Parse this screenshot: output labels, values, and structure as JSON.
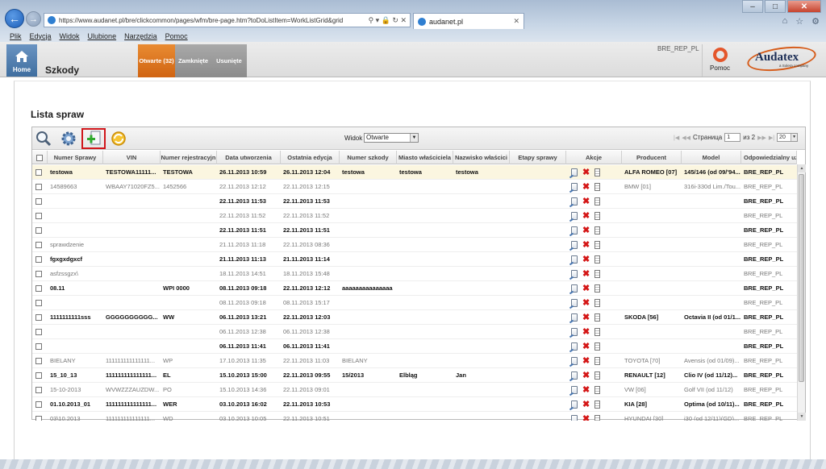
{
  "browser": {
    "url": "https://www.audanet.pl/bre/clickcommon/pages/wfm/bre-page.htm?toDoListItem=WorkListGrid&grid",
    "tab_title": "audanet.pl",
    "menu": [
      "Plik",
      "Edycja",
      "Widok",
      "Ulubione",
      "Narzędzia",
      "Pomoc"
    ]
  },
  "header": {
    "home_label": "Home",
    "module_title": "Szkody",
    "tabs": [
      {
        "label": "Otwarte (32)",
        "active": true
      },
      {
        "label": "Zamknięte",
        "active": false
      },
      {
        "label": "Usunięte",
        "active": false
      }
    ],
    "user": "BRE_REP_PL",
    "help_label": "Pomoc",
    "logo_name": "Audatex",
    "logo_sub": "a Solera company"
  },
  "list": {
    "title": "Lista spraw",
    "view_label": "Widok",
    "view_value": "Otwarte",
    "pager": {
      "label": "Страница",
      "page": "1",
      "of_label": "из 2",
      "page_size": "20"
    }
  },
  "columns": [
    "Numer Sprawy",
    "VIN",
    "Numer rejestracyjn",
    "Data utworzenia",
    "Ostatnia edycja",
    "Numer szkody",
    "Miasto właściciela",
    "Nazwisko właścici",
    "Etapy sprawy",
    "Akcje",
    "Producent",
    "Model",
    "Odpowiedzialny uż"
  ],
  "rows": [
    {
      "style": "b sel",
      "num": "testowa",
      "vin": "TESTOWA11111...",
      "reg": "TESTOWA",
      "created": "26.11.2013 10:59",
      "edited": "26.11.2013 12:04",
      "claim": "testowa",
      "city": "testowa",
      "owner": "testowa",
      "maker": "ALFA ROMEO [07]",
      "model": "145/146 (od 09/'94...",
      "user": "BRE_REP_PL"
    },
    {
      "style": "g",
      "num": "14589663",
      "vin": "WBAAY71020FZ5...",
      "reg": "1452566",
      "created": "22.11.2013 12:12",
      "edited": "22.11.2013 12:15",
      "claim": "",
      "city": "",
      "owner": "",
      "maker": "BMW [01]",
      "model": "316i-330d Lim./Tou...",
      "user": "BRE_REP_PL"
    },
    {
      "style": "b",
      "num": "",
      "vin": "",
      "reg": "",
      "created": "22.11.2013 11:53",
      "edited": "22.11.2013 11:53",
      "claim": "",
      "city": "",
      "owner": "",
      "maker": "",
      "model": "",
      "user": "BRE_REP_PL"
    },
    {
      "style": "g",
      "num": "",
      "vin": "",
      "reg": "",
      "created": "22.11.2013 11:52",
      "edited": "22.11.2013 11:52",
      "claim": "",
      "city": "",
      "owner": "",
      "maker": "",
      "model": "",
      "user": "BRE_REP_PL"
    },
    {
      "style": "b",
      "num": "",
      "vin": "",
      "reg": "",
      "created": "22.11.2013 11:51",
      "edited": "22.11.2013 11:51",
      "claim": "",
      "city": "",
      "owner": "",
      "maker": "",
      "model": "",
      "user": "BRE_REP_PL"
    },
    {
      "style": "g",
      "num": "sprawdzenie",
      "vin": "",
      "reg": "",
      "created": "21.11.2013 11:18",
      "edited": "22.11.2013 08:36",
      "claim": "",
      "city": "",
      "owner": "",
      "maker": "",
      "model": "",
      "user": "BRE_REP_PL"
    },
    {
      "style": "b",
      "num": "fgxgxdgxcf",
      "vin": "",
      "reg": "",
      "created": "21.11.2013 11:13",
      "edited": "21.11.2013 11:14",
      "claim": "",
      "city": "",
      "owner": "",
      "maker": "",
      "model": "",
      "user": "BRE_REP_PL"
    },
    {
      "style": "g",
      "num": "asfzssgzx\\",
      "vin": "",
      "reg": "",
      "created": "18.11.2013 14:51",
      "edited": "18.11.2013 15:48",
      "claim": "",
      "city": "",
      "owner": "",
      "maker": "",
      "model": "",
      "user": "BRE_REP_PL"
    },
    {
      "style": "b",
      "num": "08.11",
      "vin": "",
      "reg": "WPI 0000",
      "created": "08.11.2013 09:18",
      "edited": "22.11.2013 12:12",
      "claim": "aaaaaaaaaaaaaaa",
      "city": "",
      "owner": "",
      "maker": "",
      "model": "",
      "user": "BRE_REP_PL"
    },
    {
      "style": "g",
      "num": "",
      "vin": "",
      "reg": "",
      "created": "08.11.2013 09:18",
      "edited": "08.11.2013 15:17",
      "claim": "",
      "city": "",
      "owner": "",
      "maker": "",
      "model": "",
      "user": "BRE_REP_PL"
    },
    {
      "style": "b",
      "num": "1111111111sss",
      "vin": "GGGGGGGGGG...",
      "reg": "WW",
      "created": "06.11.2013 13:21",
      "edited": "22.11.2013 12:03",
      "claim": "",
      "city": "",
      "owner": "",
      "maker": "SKODA [56]",
      "model": "Octavia II (od 01/1...",
      "user": "BRE_REP_PL"
    },
    {
      "style": "g",
      "num": "",
      "vin": "",
      "reg": "",
      "created": "06.11.2013 12:38",
      "edited": "06.11.2013 12:38",
      "claim": "",
      "city": "",
      "owner": "",
      "maker": "",
      "model": "",
      "user": "BRE_REP_PL"
    },
    {
      "style": "b",
      "num": "",
      "vin": "",
      "reg": "",
      "created": "06.11.2013 11:41",
      "edited": "06.11.2013 11:41",
      "claim": "",
      "city": "",
      "owner": "",
      "maker": "",
      "model": "",
      "user": "BRE_REP_PL"
    },
    {
      "style": "g",
      "num": "BIELANY",
      "vin": "111111111111111...",
      "reg": "WP",
      "created": "17.10.2013 11:35",
      "edited": "22.11.2013 11:03",
      "claim": "BIELANY",
      "city": "",
      "owner": "",
      "maker": "TOYOTA [70]",
      "model": "Avensis (od 01/09)...",
      "user": "BRE_REP_PL"
    },
    {
      "style": "b",
      "num": "15_10_13",
      "vin": "111111111111111...",
      "reg": "EL",
      "created": "15.10.2013 15:00",
      "edited": "22.11.2013 09:55",
      "claim": "15/2013",
      "city": "Elbląg",
      "owner": "Jan",
      "maker": "RENAULT [12]",
      "model": "Clio IV (od 11/12)...",
      "user": "BRE_REP_PL"
    },
    {
      "style": "g",
      "num": "15-10-2013",
      "vin": "WVWZZZAUZDW...",
      "reg": "PO",
      "created": "15.10.2013 14:36",
      "edited": "22.11.2013 09:01",
      "claim": "",
      "city": "",
      "owner": "",
      "maker": "VW [06]",
      "model": "Golf VII (od 11/12)",
      "user": "BRE_REP_PL"
    },
    {
      "style": "b",
      "num": "01.10.2013_01",
      "vin": "111111111111111...",
      "reg": "WER",
      "created": "03.10.2013 16:02",
      "edited": "22.11.2013 10:53",
      "claim": "",
      "city": "",
      "owner": "",
      "maker": "KIA [28]",
      "model": "Optima (od 10/11)...",
      "user": "BRE_REP_PL"
    },
    {
      "style": "g",
      "num": "03\\10.2013",
      "vin": "111111111111111...",
      "reg": "WD",
      "created": "03.10.2013 10:05",
      "edited": "22.11.2013 10:51",
      "claim": "",
      "city": "",
      "owner": "",
      "maker": "HYUNDAI [30]",
      "model": "i30 (od 12/11)(GD)...",
      "user": "BRE_REP_PL"
    }
  ]
}
